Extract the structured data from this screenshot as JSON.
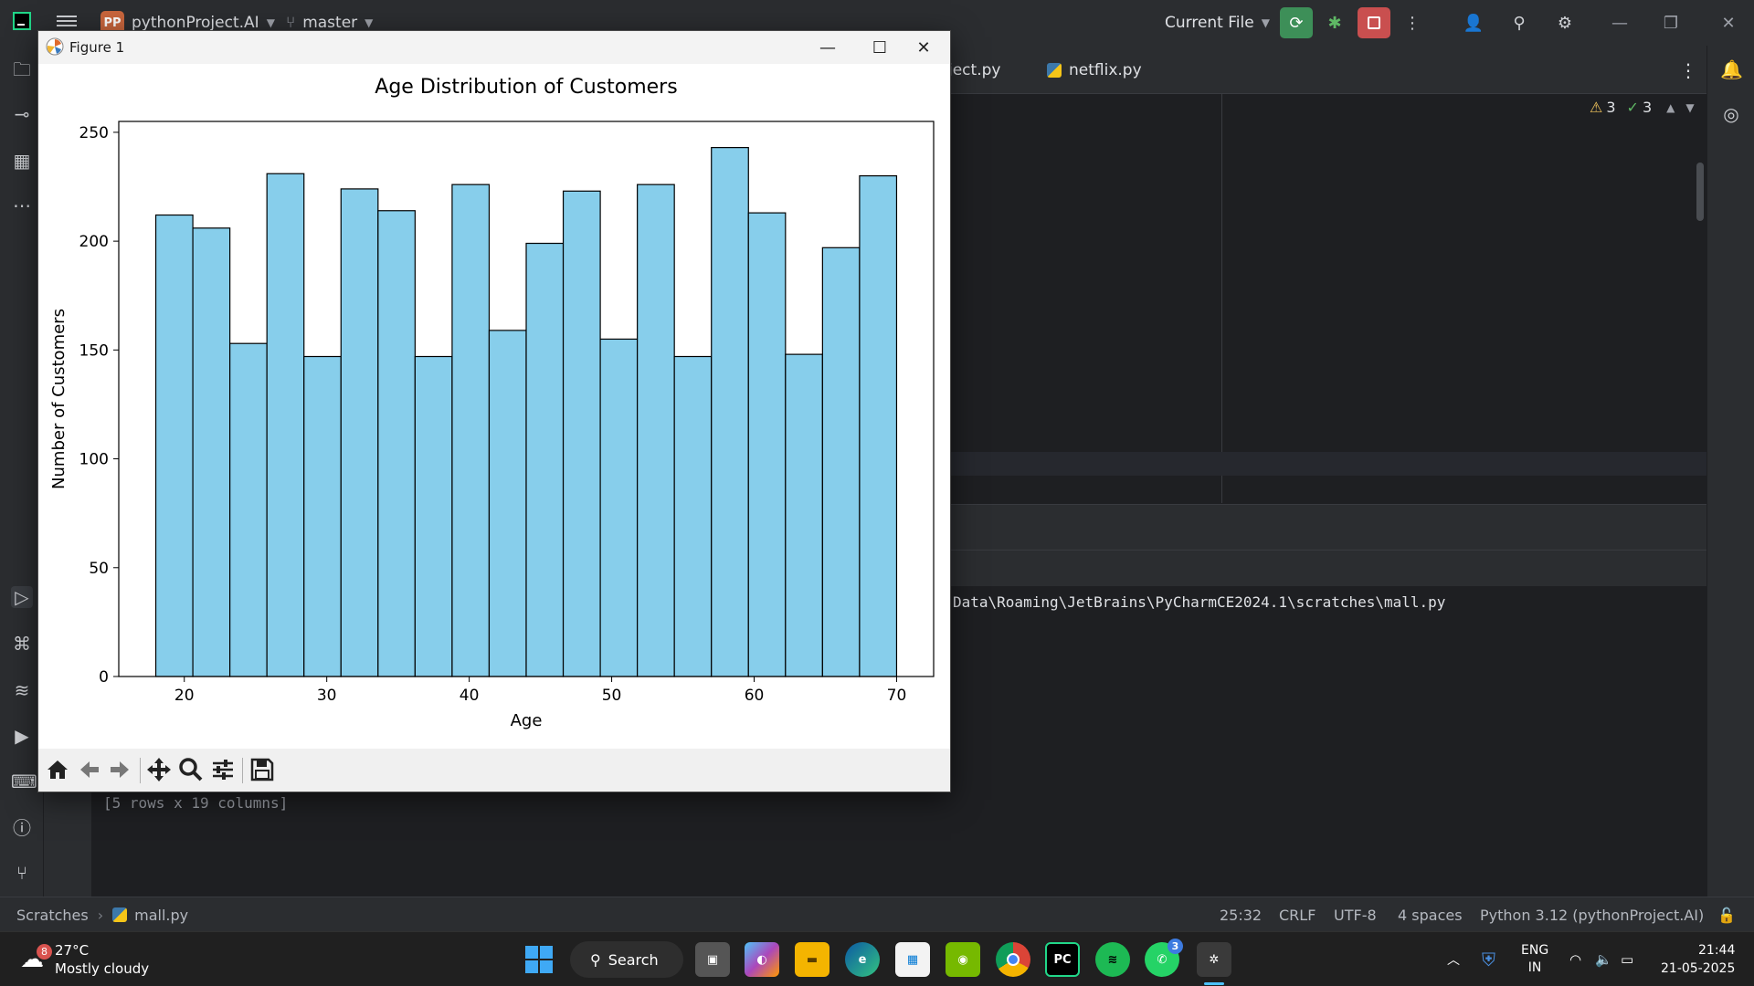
{
  "ide": {
    "project_badge": "PP",
    "project_name": "pythonProject.AI",
    "branch": "master",
    "run_config": "Current File"
  },
  "tabs": [
    "ject.py",
    "netflix.py"
  ],
  "inspections": {
    "warnings": "3",
    "ok": "3"
  },
  "console": {
    "path_line": "Data\\Roaming\\JetBrains\\PyCharmCE2024.1\\scratches\\mall.py",
    "rows_line": "[5 rows x 19 columns]"
  },
  "statusbar": {
    "crumb_root": "Scratches",
    "crumb_file": "mall.py",
    "position": "25:32",
    "line_sep": "CRLF",
    "encoding": "UTF-8",
    "indent": "4 spaces",
    "interpreter": "Python 3.12 (pythonProject.AI)"
  },
  "figure": {
    "window_title": "Figure 1"
  },
  "chart_data": {
    "type": "bar",
    "title": "Age Distribution of Customers",
    "xlabel": "Age",
    "ylabel": "Number of Customers",
    "bar_color": "#87ceeb",
    "edge_color": "#000000",
    "bin_edges": [
      18,
      20.6,
      23.2,
      25.8,
      28.4,
      31,
      33.6,
      36.2,
      38.8,
      41.4,
      44,
      46.6,
      49.2,
      51.8,
      54.4,
      57,
      59.6,
      62.2,
      64.8,
      67.4,
      70
    ],
    "values": [
      212,
      206,
      153,
      231,
      147,
      224,
      214,
      147,
      226,
      159,
      199,
      223,
      155,
      226,
      147,
      243,
      213,
      148,
      197,
      230
    ],
    "xlim": [
      15.4,
      72.6
    ],
    "ylim": [
      0,
      255
    ],
    "xticks": [
      20,
      30,
      40,
      50,
      60,
      70
    ],
    "yticks": [
      0,
      50,
      100,
      150,
      200,
      250
    ],
    "grid": false
  },
  "taskbar": {
    "weather_temp": "27°C",
    "weather_desc": "Mostly cloudy",
    "weather_badge": "8",
    "search_label": "Search",
    "whatsapp_badge": "3",
    "lang_top": "ENG",
    "lang_bottom": "IN",
    "time": "21:44",
    "date": "21-05-2025"
  }
}
